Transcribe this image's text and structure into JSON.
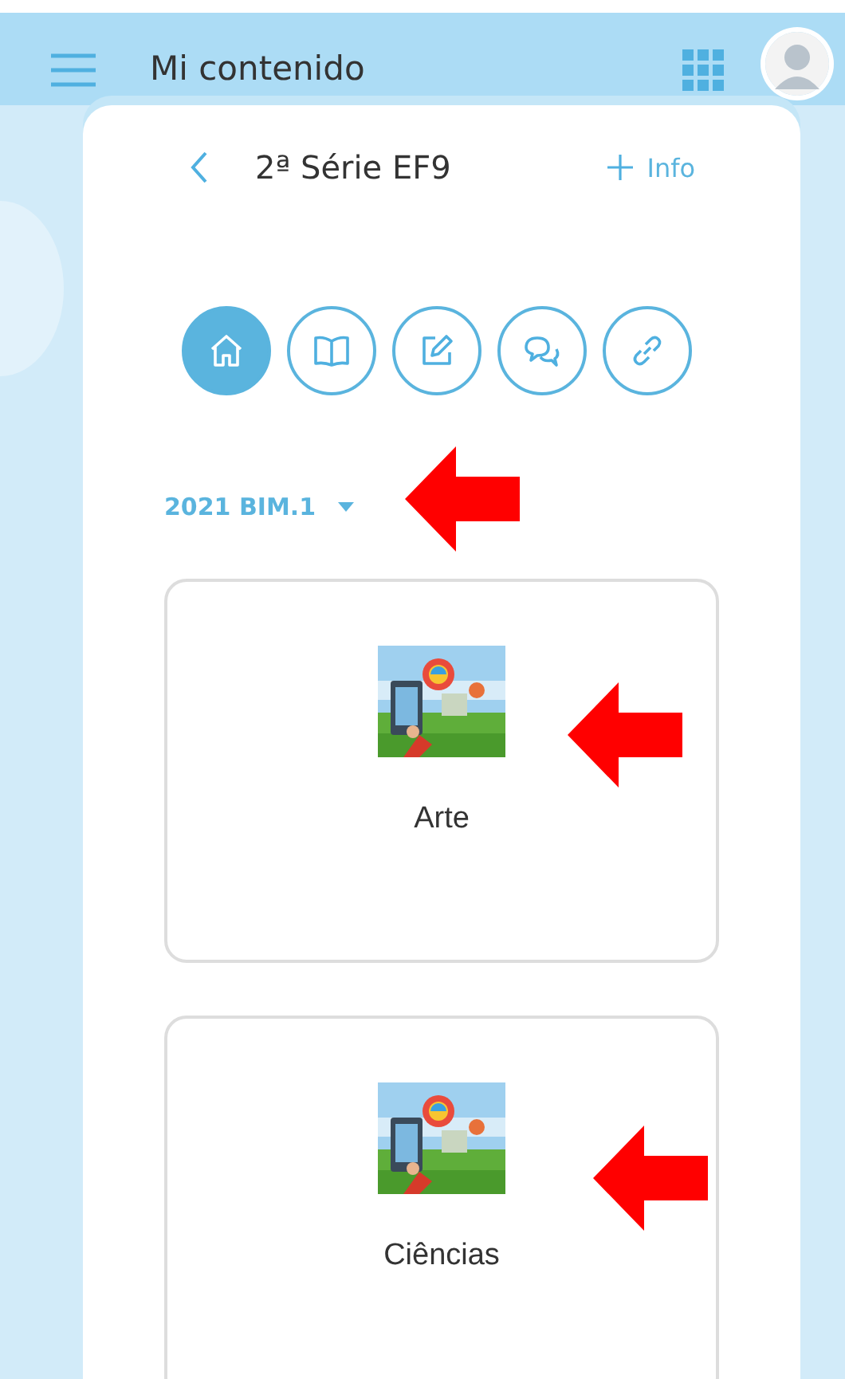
{
  "app_bar": {
    "title": "Mi contenido"
  },
  "header": {
    "title": "2ª Série EF9",
    "info": "Info"
  },
  "nav_buttons": [
    {
      "kind": "home",
      "selected": true
    },
    {
      "kind": "book",
      "selected": false
    },
    {
      "kind": "edit",
      "selected": false
    },
    {
      "kind": "chat",
      "selected": false
    },
    {
      "kind": "link",
      "selected": false
    }
  ],
  "period": {
    "value": "2021 BIM.1"
  },
  "subjects": [
    {
      "name": "Arte"
    },
    {
      "name": "Ciências"
    }
  ]
}
